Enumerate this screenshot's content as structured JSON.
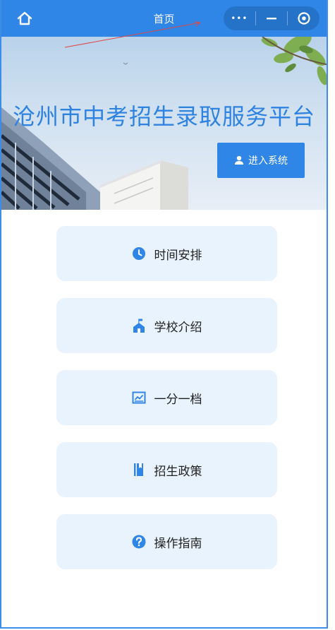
{
  "nav": {
    "title": "首页",
    "more_glyph": "•••",
    "icons": [
      "home-icon",
      "more-icon",
      "minimize-icon",
      "close-target-icon"
    ]
  },
  "banner": {
    "title": "沧州市中考招生录取服务平台",
    "enter_label": "进入系统"
  },
  "menu": {
    "items": [
      {
        "label": "时间安排",
        "icon": "clock-icon"
      },
      {
        "label": "学校介绍",
        "icon": "school-icon"
      },
      {
        "label": "一分一档",
        "icon": "chart-icon"
      },
      {
        "label": "招生政策",
        "icon": "book-icon"
      },
      {
        "label": "操作指南",
        "icon": "help-icon"
      }
    ]
  },
  "colors": {
    "primary": "#2f86e6",
    "capsule": "#2473c9",
    "menu_bg": "#e8f3fd",
    "banner_title": "#2e82e0"
  }
}
